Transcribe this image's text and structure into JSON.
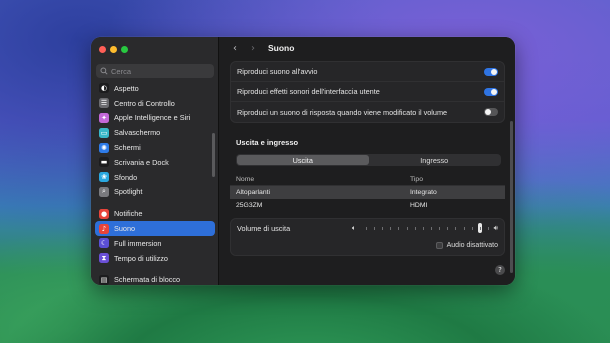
{
  "window": {
    "title": "Suono"
  },
  "search": {
    "placeholder": "Cerca"
  },
  "sidebar": {
    "items": [
      {
        "label": "Aspetto",
        "icon": "appearance-icon",
        "color": "#1c1c1e",
        "glyph": "◐"
      },
      {
        "label": "Centro di Controllo",
        "icon": "control-center-icon",
        "color": "#6b6b6f",
        "glyph": "☰"
      },
      {
        "label": "Apple Intelligence e Siri",
        "icon": "siri-icon",
        "color": "#c468d8",
        "glyph": "✦"
      },
      {
        "label": "Salvaschermo",
        "icon": "screensaver-icon",
        "color": "#39b8c9",
        "glyph": "▭"
      },
      {
        "label": "Schermi",
        "icon": "displays-icon",
        "color": "#2e7be8",
        "glyph": "✺"
      },
      {
        "label": "Scrivania e Dock",
        "icon": "desktop-dock-icon",
        "color": "#1c1c1e",
        "glyph": "▬"
      },
      {
        "label": "Sfondo",
        "icon": "wallpaper-icon",
        "color": "#2aa8e0",
        "glyph": "❀"
      },
      {
        "label": "Spotlight",
        "icon": "spotlight-icon",
        "color": "#7a7a7e",
        "glyph": "⌕"
      },
      {
        "label": "Notifiche",
        "icon": "notifications-icon",
        "color": "#e8443a",
        "glyph": "●"
      },
      {
        "label": "Suono",
        "icon": "sound-icon",
        "color": "#e8443a",
        "glyph": "♪",
        "active": true
      },
      {
        "label": "Full immersion",
        "icon": "focus-icon",
        "color": "#5b4fd6",
        "glyph": "☾"
      },
      {
        "label": "Tempo di utilizzo",
        "icon": "screen-time-icon",
        "color": "#6a4fd6",
        "glyph": "⧗"
      },
      {
        "label": "Schermata di blocco",
        "icon": "lock-screen-icon",
        "color": "#1c1c1e",
        "glyph": "▤"
      }
    ]
  },
  "settings": {
    "toggles": [
      {
        "label": "Riproduci suono all'avvio",
        "state": "on"
      },
      {
        "label": "Riproduci effetti sonori dell'interfaccia utente",
        "state": "on"
      },
      {
        "label": "Riproduci un suono di risposta quando viene modificato il volume",
        "state": "off"
      }
    ],
    "section_title": "Uscita e ingresso",
    "tabs": [
      {
        "label": "Uscita",
        "active": true
      },
      {
        "label": "Ingresso",
        "active": false
      }
    ],
    "devices": {
      "columns": [
        "Nome",
        "Tipo"
      ],
      "rows": [
        {
          "name": "Altoparlanti",
          "type": "Integrato",
          "selected": true
        },
        {
          "name": "25G3ZM",
          "type": "HDMI",
          "selected": false
        }
      ]
    },
    "volume": {
      "label": "Volume di uscita",
      "level": 0.94,
      "mute_label": "Audio disattivato",
      "muted": false
    }
  },
  "colors": {
    "accent": "#2f74e3",
    "sidebar_bg": "#2a2a2c",
    "content_bg": "#1e1e1f"
  }
}
